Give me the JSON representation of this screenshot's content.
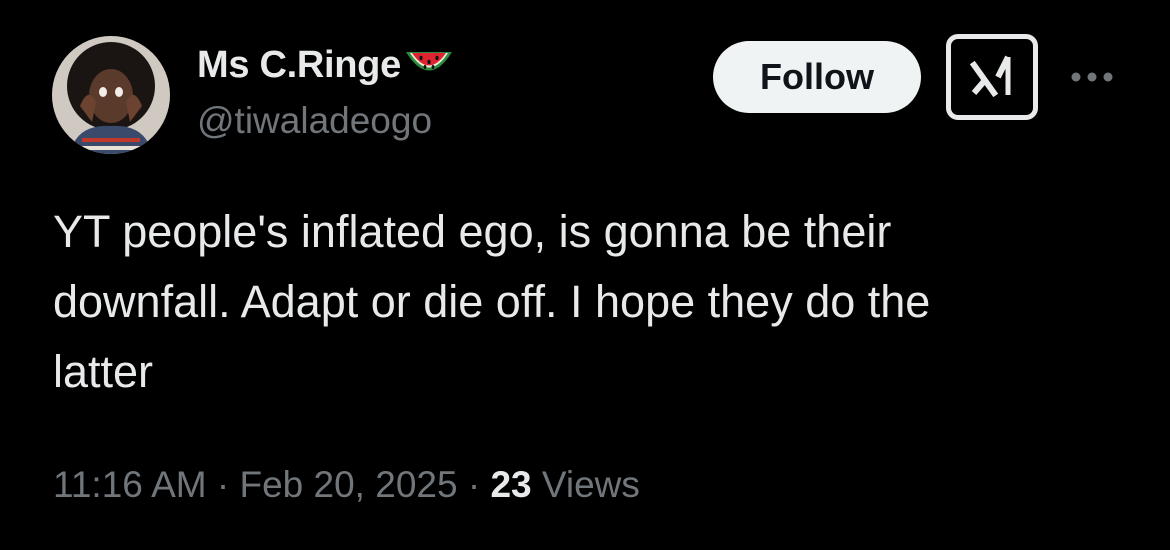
{
  "author": {
    "display_name": "Ms C.Ringe",
    "name_emoji": "watermelon-icon",
    "handle": "@tiwaladeogo",
    "avatar": "avatar-photo"
  },
  "actions": {
    "follow_label": "Follow",
    "grok_icon": "grok-icon",
    "more_icon": "more-horizontal-icon"
  },
  "tweet": {
    "text": "YT people's inflated ego, is gonna be their\ndownfall. Adapt or die off. I hope they do the\nlatter"
  },
  "meta": {
    "time": "11:16 AM",
    "separator": "·",
    "date": "Feb 20, 2025",
    "views_count": "23",
    "views_label": "Views"
  },
  "colors": {
    "background": "#000000",
    "primary_text": "#e7e9ea",
    "secondary_text": "#71767b",
    "follow_button_bg": "#eff3f4",
    "follow_button_text": "#0f1419"
  }
}
